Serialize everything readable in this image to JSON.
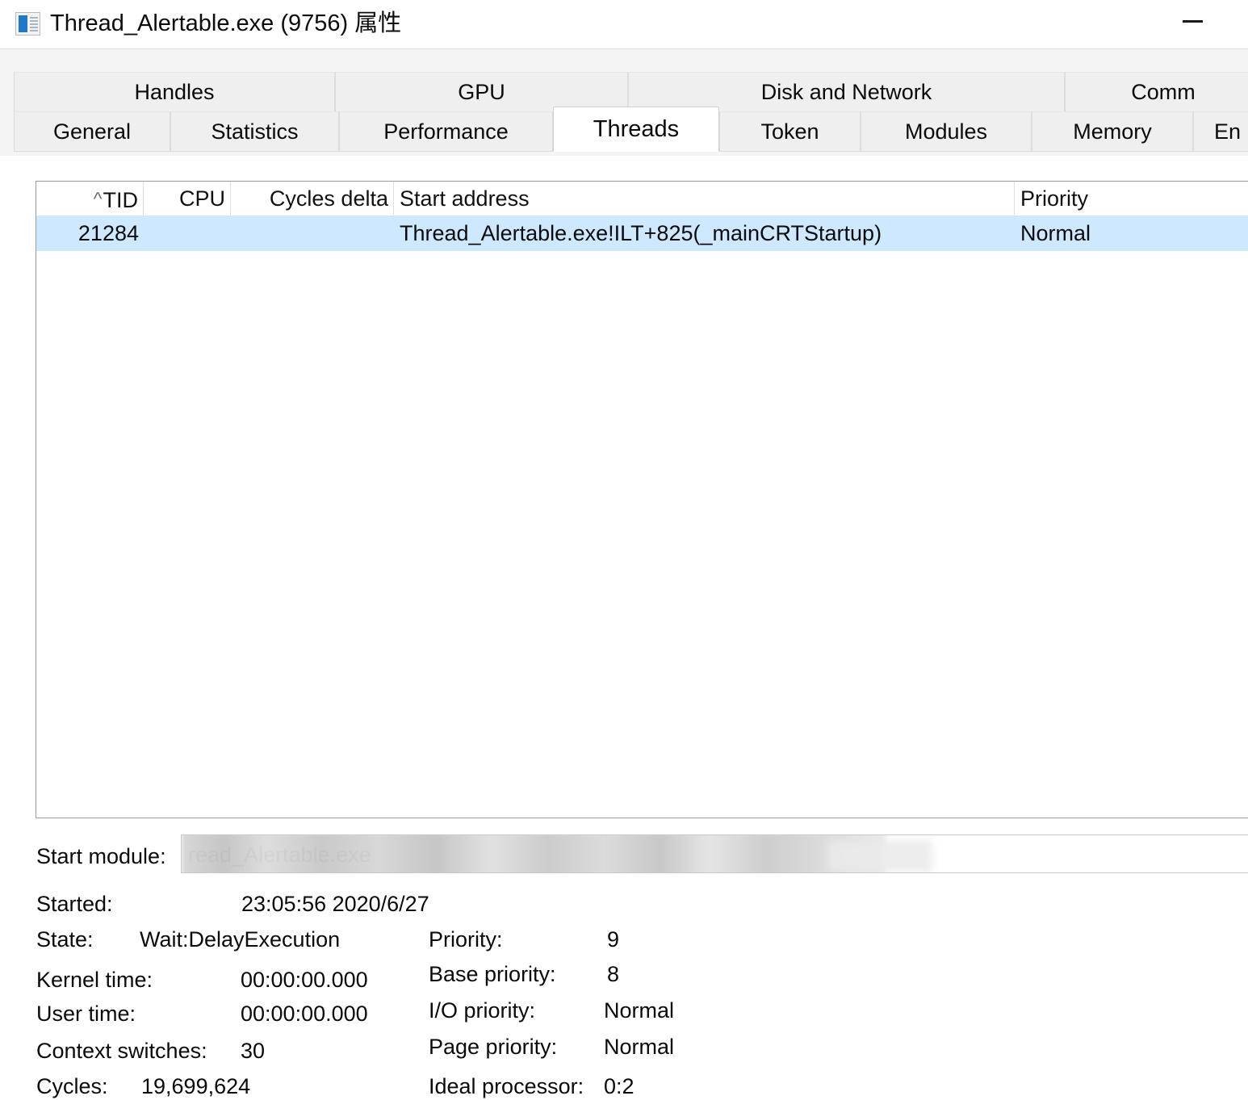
{
  "window": {
    "title": "Thread_Alertable.exe (9756) 属性",
    "icon": "process-properties-icon",
    "minimize_label": "—"
  },
  "tabs": {
    "top_row": [
      {
        "label": "Handles",
        "selected": false
      },
      {
        "label": "GPU",
        "selected": false
      },
      {
        "label": "Disk and Network",
        "selected": false
      },
      {
        "label": "Comm",
        "selected": false
      }
    ],
    "bottom_row": [
      {
        "label": "General",
        "selected": false
      },
      {
        "label": "Statistics",
        "selected": false
      },
      {
        "label": "Performance",
        "selected": false
      },
      {
        "label": "Threads",
        "selected": true
      },
      {
        "label": "Token",
        "selected": false
      },
      {
        "label": "Modules",
        "selected": false
      },
      {
        "label": "Memory",
        "selected": false
      },
      {
        "label": "En",
        "selected": false
      }
    ]
  },
  "thread_list": {
    "sort_indicator": "^",
    "columns": [
      {
        "label": "TID",
        "align": "num"
      },
      {
        "label": "CPU",
        "align": "num"
      },
      {
        "label": "Cycles delta",
        "align": "num"
      },
      {
        "label": "Start address",
        "align": "txt"
      },
      {
        "label": "Priority",
        "align": "txt"
      }
    ],
    "rows": [
      {
        "selected": true,
        "tid": "21284",
        "cpu": "",
        "cycles_delta": "",
        "start_address": "Thread_Alertable.exe!ILT+825(_mainCRTStartup)",
        "priority": "Normal"
      }
    ]
  },
  "details": {
    "start_module_label": "Start module:",
    "start_module_value": "read_Alertable.exe",
    "start_module_redacted": true,
    "started_label": "Started:",
    "started_value": "23:05:56 2020/6/27",
    "state_label": "State:",
    "state_value": "Wait:DelayExecution",
    "kernel_time_label": "Kernel time:",
    "kernel_time_value": "00:00:00.000",
    "user_time_label": "User time:",
    "user_time_value": "00:00:00.000",
    "context_switches_label": "Context switches:",
    "context_switches_value": "30",
    "cycles_label": "Cycles:",
    "cycles_value": "19,699,624",
    "priority_label": "Priority:",
    "priority_value": "9",
    "base_priority_label": "Base priority:",
    "base_priority_value": "8",
    "io_priority_label": "I/O priority:",
    "io_priority_value": "Normal",
    "page_priority_label": "Page priority:",
    "page_priority_value": "Normal",
    "ideal_processor_label": "Ideal processor:",
    "ideal_processor_value": "0:2"
  },
  "colors": {
    "selection": "#cde8ff",
    "tab_bar": "#f4f4f4",
    "tab_face": "#efefef",
    "tab_selected": "#ffffff",
    "border": "#9a9a9a",
    "text": "#0b0b0b",
    "icon_blue": "#1f79c8"
  }
}
